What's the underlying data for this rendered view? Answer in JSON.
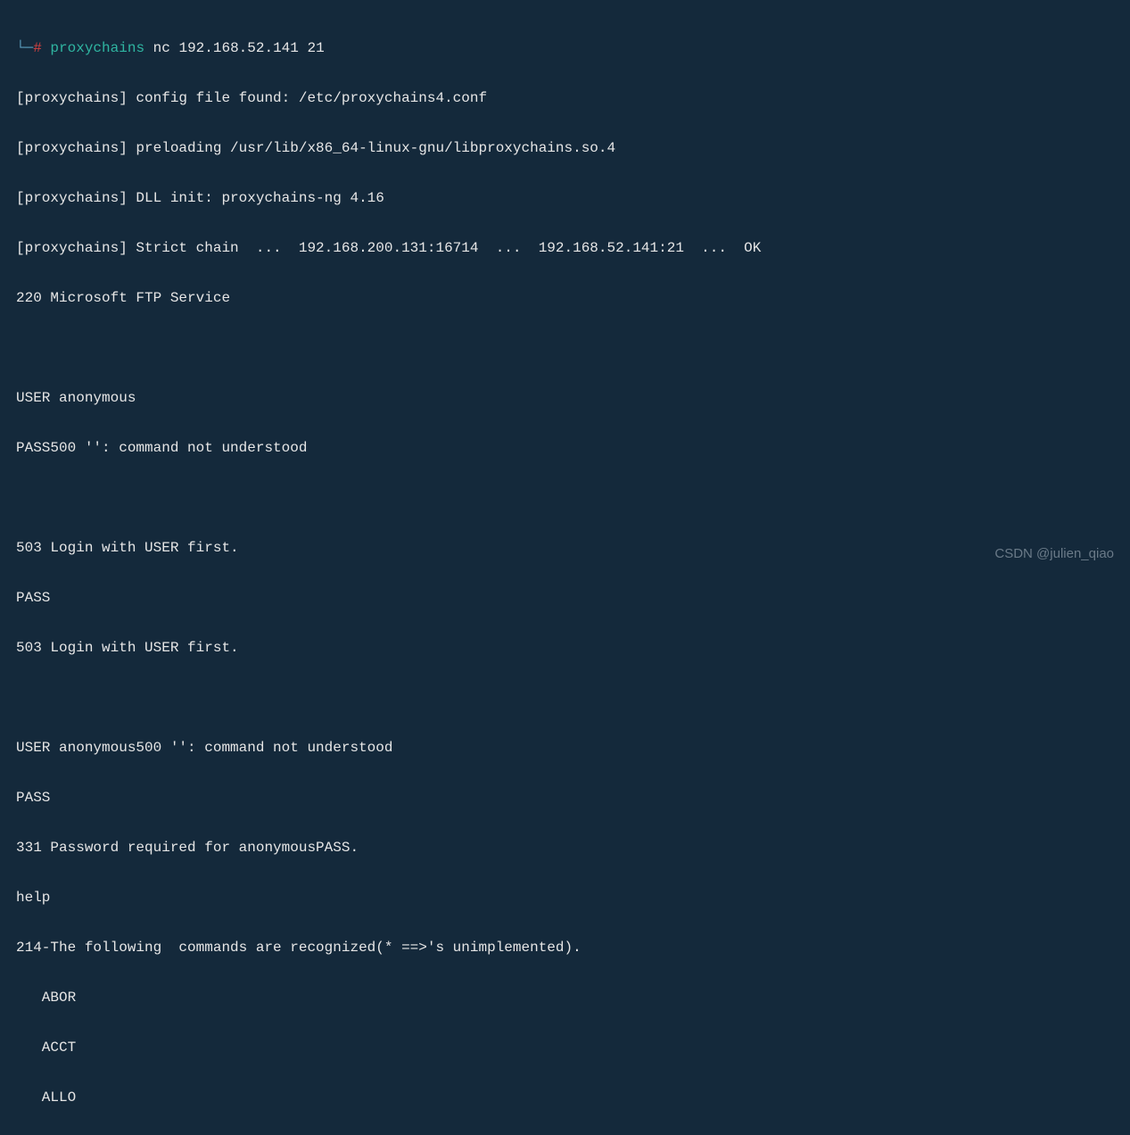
{
  "prompt": {
    "tree": "└─",
    "hash": "#",
    "command": "proxychains",
    "args": "nc 192.168.52.141 21"
  },
  "lines": {
    "l1": "[proxychains] config file found: /etc/proxychains4.conf",
    "l2": "[proxychains] preloading /usr/lib/x86_64-linux-gnu/libproxychains.so.4",
    "l3": "[proxychains] DLL init: proxychains-ng 4.16",
    "l4": "[proxychains] Strict chain  ...  192.168.200.131:16714  ...  192.168.52.141:21  ...  OK",
    "l5": "220 Microsoft FTP Service",
    "l6": "",
    "l7": "USER anonymous",
    "l8": "PASS500 '': command not understood",
    "l9": "",
    "l10": "503 Login with USER first.",
    "l11": "PASS",
    "l12": "503 Login with USER first.",
    "l13": "",
    "l14": "USER anonymous500 '': command not understood",
    "l15": "PASS",
    "l16": "331 Password required for anonymousPASS.",
    "l17": "help",
    "l18": "214-The following  commands are recognized(* ==>'s unimplemented).",
    "l19": "   ABOR",
    "l20": "   ACCT",
    "l21": "   ALLO"
  },
  "watermark": "CSDN @julien_qiao"
}
